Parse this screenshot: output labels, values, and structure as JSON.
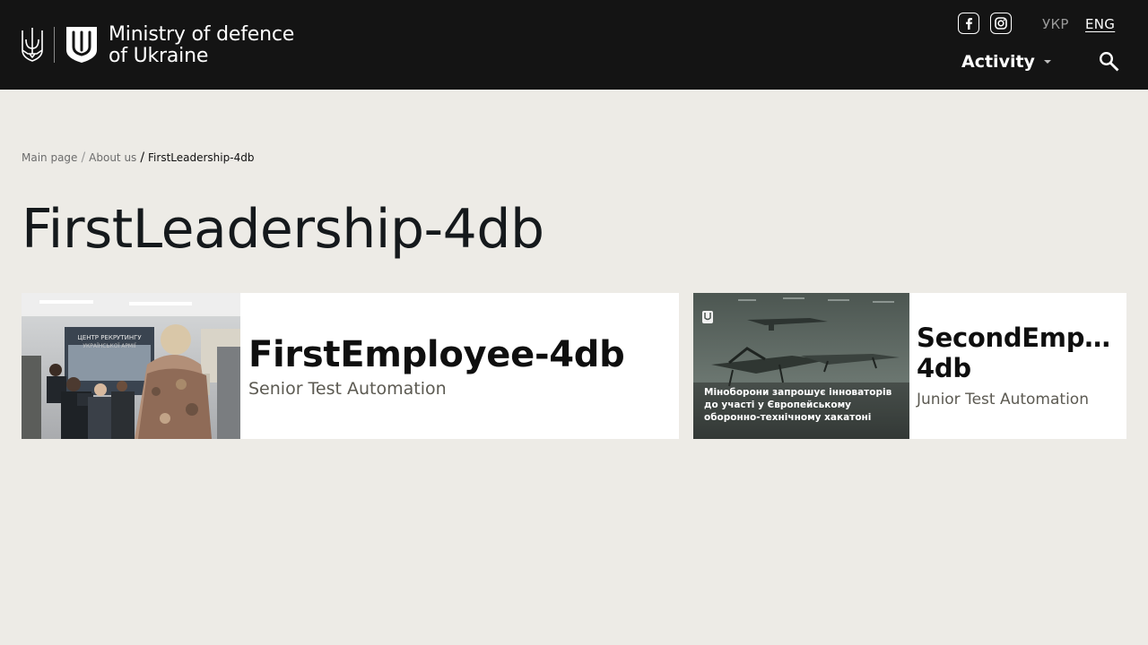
{
  "header": {
    "logo_line1": "Ministry of defence",
    "logo_line2": "of Ukraine",
    "social_icons": [
      "facebook-icon",
      "instagram-icon"
    ],
    "lang_ukr": "УКР",
    "lang_eng": "ENG",
    "nav_activity": "Activity",
    "background": "#141414"
  },
  "breadcrumb": {
    "items": [
      "Main page",
      "About us",
      "FirstLeadership-4db"
    ],
    "separator": "/"
  },
  "page_title": "FirstLeadership-4db",
  "cards": [
    {
      "name": "FirstEmployee-4db",
      "role": "Senior Test Automation",
      "image_caption": [
        "ЦЕНТР РЕКРУТИНГУ",
        "УКРАЇНСЬКОЇ АРМІЇ"
      ]
    },
    {
      "name_line1": "SecondEmpl...",
      "name_line2": "4db",
      "role": "Junior Test Automation",
      "image_caption": [
        "Міноборони запрошує інноваторів",
        "до участі у Європейському",
        "оборонно-технічному хакатоні"
      ]
    }
  ],
  "colors": {
    "page_background": "#edebe6",
    "title_text": "#15191c",
    "role_text": "#5c5a52"
  }
}
